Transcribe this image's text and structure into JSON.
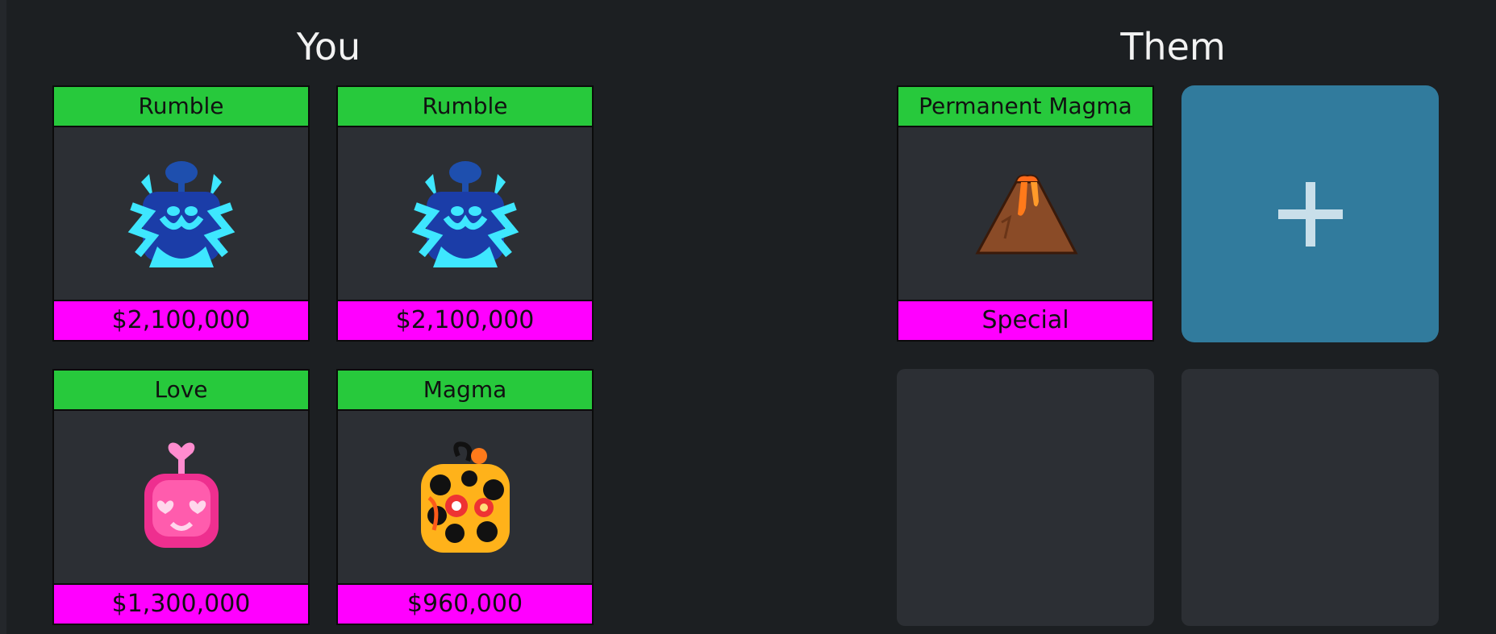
{
  "you": {
    "title": "You",
    "items": [
      {
        "name": "Rumble",
        "value": "$2,100,000",
        "icon": "rumble-fruit-icon"
      },
      {
        "name": "Rumble",
        "value": "$2,100,000",
        "icon": "rumble-fruit-icon"
      },
      {
        "name": "Love",
        "value": "$1,300,000",
        "icon": "love-fruit-icon"
      },
      {
        "name": "Magma",
        "value": "$960,000",
        "icon": "magma-fruit-icon"
      }
    ]
  },
  "them": {
    "title": "Them",
    "items": [
      {
        "name": "Permanent Magma",
        "value": "Special",
        "icon": "volcano-icon"
      }
    ],
    "add_slot_icon": "plus-icon"
  },
  "colors": {
    "background": "#1c1f22",
    "name_bar": "#27c93c",
    "price_bar": "#ff00ff",
    "add_button": "#317b9d",
    "card": "#2c2f34"
  }
}
